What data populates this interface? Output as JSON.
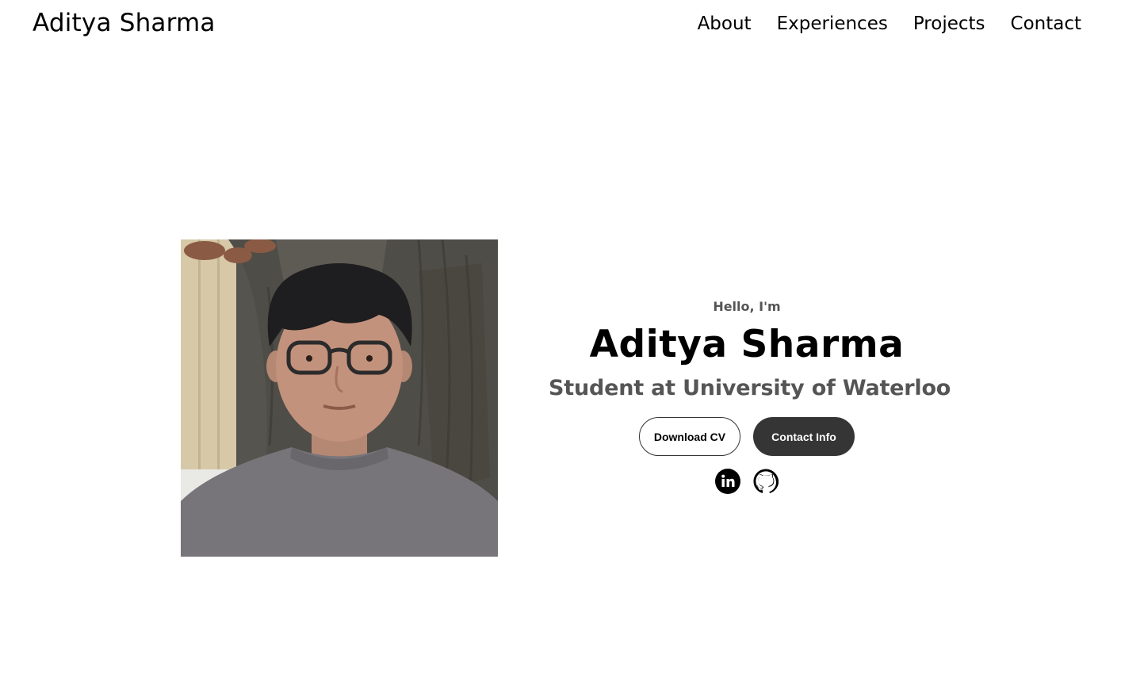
{
  "nav": {
    "logo": "Aditya Sharma",
    "links": [
      {
        "label": "About"
      },
      {
        "label": "Experiences"
      },
      {
        "label": "Projects"
      },
      {
        "label": "Contact"
      }
    ]
  },
  "hero": {
    "photo_alt": "Aditya Sharma profile picture",
    "greeting": "Hello, I'm",
    "name": "Aditya Sharma",
    "role": "Student at University of Waterloo",
    "buttons": {
      "download_cv": "Download CV",
      "contact_info": "Contact Info"
    },
    "socials": [
      {
        "icon": "linkedin-icon",
        "label": "LinkedIn"
      },
      {
        "icon": "github-icon",
        "label": "GitHub"
      }
    ]
  },
  "colors": {
    "button_dark": "#353535",
    "subtitle_gray": "#555555",
    "background": "#ffffff"
  }
}
